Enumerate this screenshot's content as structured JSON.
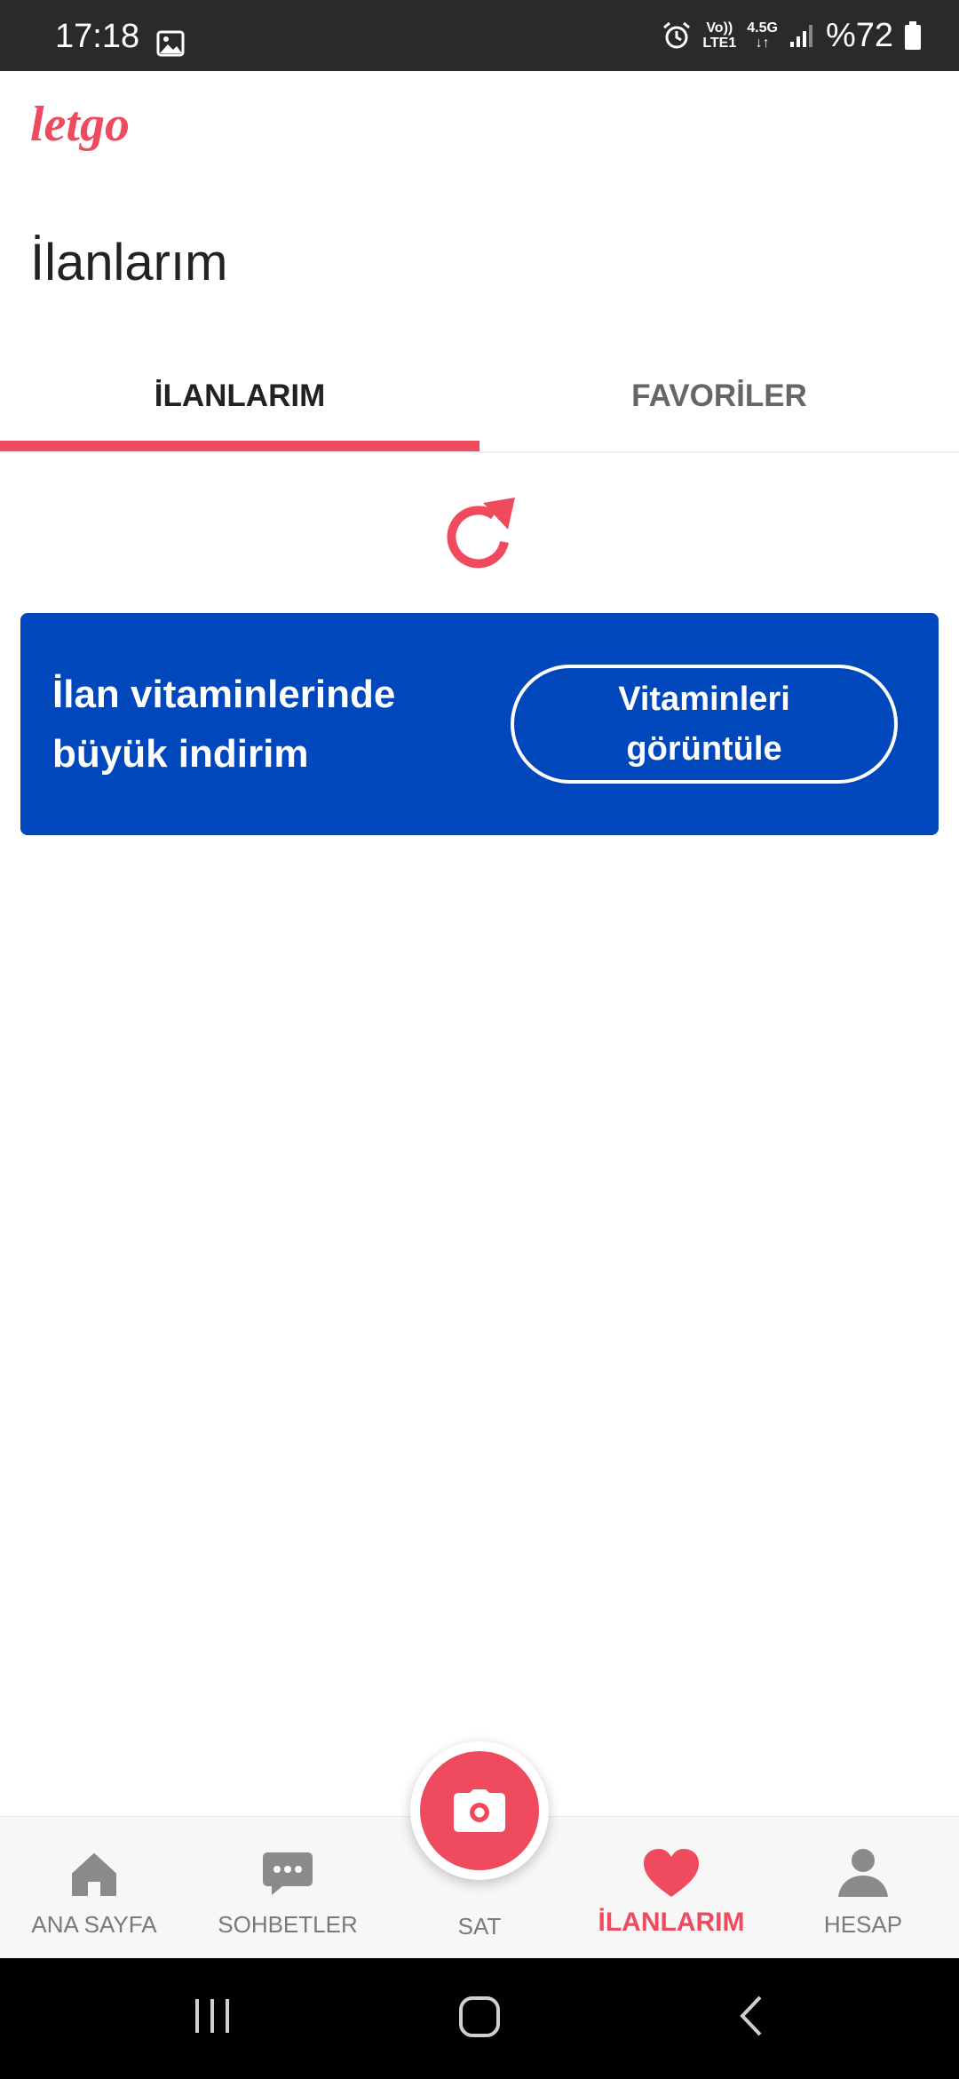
{
  "status_bar": {
    "time": "17:18",
    "network_top": "Vo))",
    "network_bottom": "LTE1",
    "data_top": "4.5G",
    "data_bottom": "↓↑",
    "battery_text": "%72"
  },
  "header": {
    "logo_text": "letgo",
    "page_title": "İlanlarım"
  },
  "tabs": [
    {
      "label": "İLANLARIM",
      "active": true
    },
    {
      "label": "FAVORİLER",
      "active": false
    }
  ],
  "banner": {
    "text_line1": "İlan vitaminlerinde",
    "text_line2": "büyük indirim",
    "button_line1": "Vitaminleri",
    "button_line2": "görüntüle"
  },
  "bottom_nav": {
    "items": [
      {
        "label": "ANA SAYFA",
        "icon": "home-icon"
      },
      {
        "label": "SOHBETLER",
        "icon": "chat-icon"
      },
      {
        "label": "SAT",
        "icon": "camera-icon"
      },
      {
        "label": "İLANLARIM",
        "icon": "heart-icon",
        "active": true
      },
      {
        "label": "HESAP",
        "icon": "person-icon"
      }
    ]
  },
  "colors": {
    "accent": "#f04a5e",
    "banner": "#0047bc",
    "status_bar": "#2a2a2a"
  }
}
